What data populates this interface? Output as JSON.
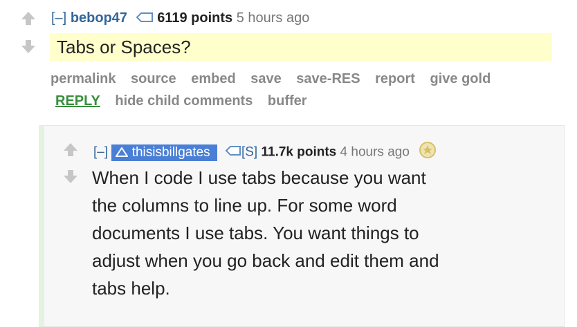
{
  "parent": {
    "collapse": "[–]",
    "author": "bebop47",
    "score": "6119 points",
    "time": "5 hours ago",
    "body": "Tabs or Spaces?",
    "actions": [
      "permalink",
      "source",
      "embed",
      "save",
      "save-RES",
      "report",
      "give gold"
    ],
    "actions2": {
      "reply": "REPLY",
      "hide": "hide child comments",
      "buffer": "buffer"
    }
  },
  "child": {
    "collapse": "[–]",
    "author": "thisisbillgates",
    "tag": "[S]",
    "score": "11.7k points",
    "time": "4 hours ago",
    "body_lines": [
      "When I code I use tabs because you want",
      "the columns to line up. For some word",
      "documents I use tabs. You want things to",
      "adjust when you go back and edit them and",
      "tabs help."
    ]
  },
  "colors": {
    "highlight": "#ffffcc",
    "author": "#336699",
    "reply": "#388e3c",
    "flair_bg": "#4a7fd6"
  }
}
